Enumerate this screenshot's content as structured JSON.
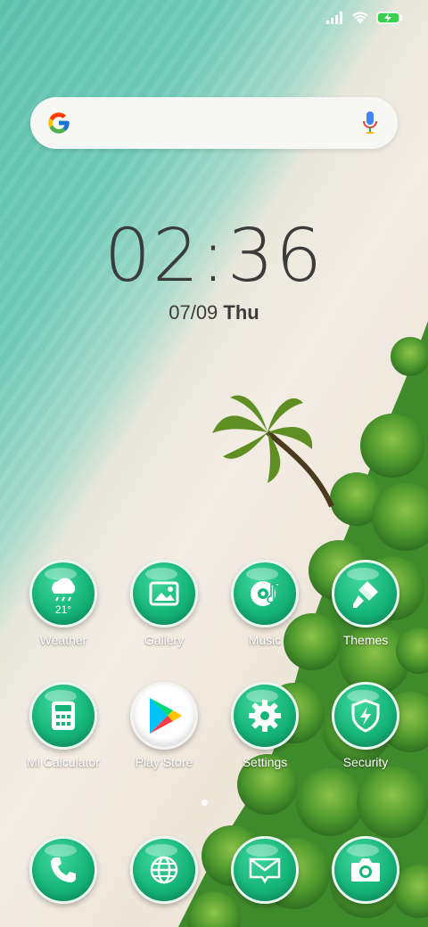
{
  "status_bar": {
    "signal_icon": "signal-icon",
    "wifi_icon": "wifi-icon",
    "battery_icon": "battery-charging-icon"
  },
  "search": {
    "icon": "google-logo",
    "voice_icon": "microphone-icon"
  },
  "clock": {
    "time": "02:36",
    "date": "07/09",
    "day": "Thu"
  },
  "apps": [
    {
      "label": "Weather",
      "icon": "weather-cloud-rain-icon",
      "temp": "21°"
    },
    {
      "label": "Gallery",
      "icon": "image-icon"
    },
    {
      "label": "Music",
      "icon": "music-disc-icon"
    },
    {
      "label": "Themes",
      "icon": "paintbrush-icon"
    },
    {
      "label": "Mi Calculator",
      "icon": "calculator-icon"
    },
    {
      "label": "Play Store",
      "icon": "play-store-icon"
    },
    {
      "label": "Settings",
      "icon": "gear-icon"
    },
    {
      "label": "Security",
      "icon": "shield-lightning-icon"
    }
  ],
  "dock": [
    {
      "icon": "phone-icon"
    },
    {
      "icon": "browser-globe-icon"
    },
    {
      "icon": "messages-envelope-icon"
    },
    {
      "icon": "camera-icon"
    }
  ],
  "page_indicator": {
    "pages": 2,
    "current": 1
  },
  "colors": {
    "icon_green": "#16b57a",
    "text_dark": "#3b3b3b"
  }
}
